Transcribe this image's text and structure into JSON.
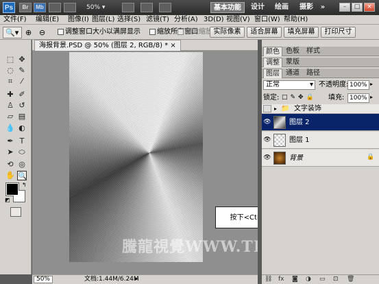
{
  "titlebar": {
    "logo": "Ps",
    "br_button": "Br",
    "mb_button": "Mb",
    "zoom": "50%",
    "workspaces": [
      "基本功能",
      "设计",
      "绘画",
      "摄影",
      "»"
    ],
    "window_controls": [
      "–",
      "□",
      "×"
    ]
  },
  "menu": [
    "文件(F)",
    "编辑(E)",
    "图像(I)",
    "图层(L)",
    "选择(S)",
    "滤镜(T)",
    "分析(A)",
    "3D(D)",
    "视图(V)",
    "窗口(W)",
    "帮助(H)"
  ],
  "options": {
    "check1": "调整窗口大小以满屏显示",
    "check2": "缩放所有窗口",
    "check3": "细微缩放",
    "btn_actual": "实际像素",
    "btn_fit": "适合屏幕",
    "btn_fill": "填充屏幕",
    "btn_print": "打印尺寸"
  },
  "document": {
    "tab_title": "海报背景.PSD @ 50% (图层 2, RGB/8) * ×",
    "zoom": "50%",
    "doc_info": "文档:1.44M/6.24M"
  },
  "callout": "按下<Ctrl+F>键重复执行上次滤镜命令",
  "watermark": "騰龍視覺WWW.TLVI.NET",
  "panels": {
    "tabs_top": [
      "颜色",
      "色板",
      "样式"
    ],
    "tabs_mid": [
      "调整",
      "蒙版"
    ],
    "tabs_layers": [
      "图层",
      "通道",
      "路径"
    ],
    "blend_mode": "正常",
    "opacity_label": "不透明度:",
    "opacity": "100%",
    "lock_label": "锁定:",
    "fill_label": "填充:",
    "fill": "100%",
    "group_name": "文字装饰",
    "layers": [
      {
        "name": "图层 2",
        "selected": true
      },
      {
        "name": "图层 1",
        "selected": false
      },
      {
        "name": "背景",
        "selected": false
      }
    ]
  },
  "colors": {
    "selection": "#0a246a",
    "accent": "#1e6ab8"
  }
}
